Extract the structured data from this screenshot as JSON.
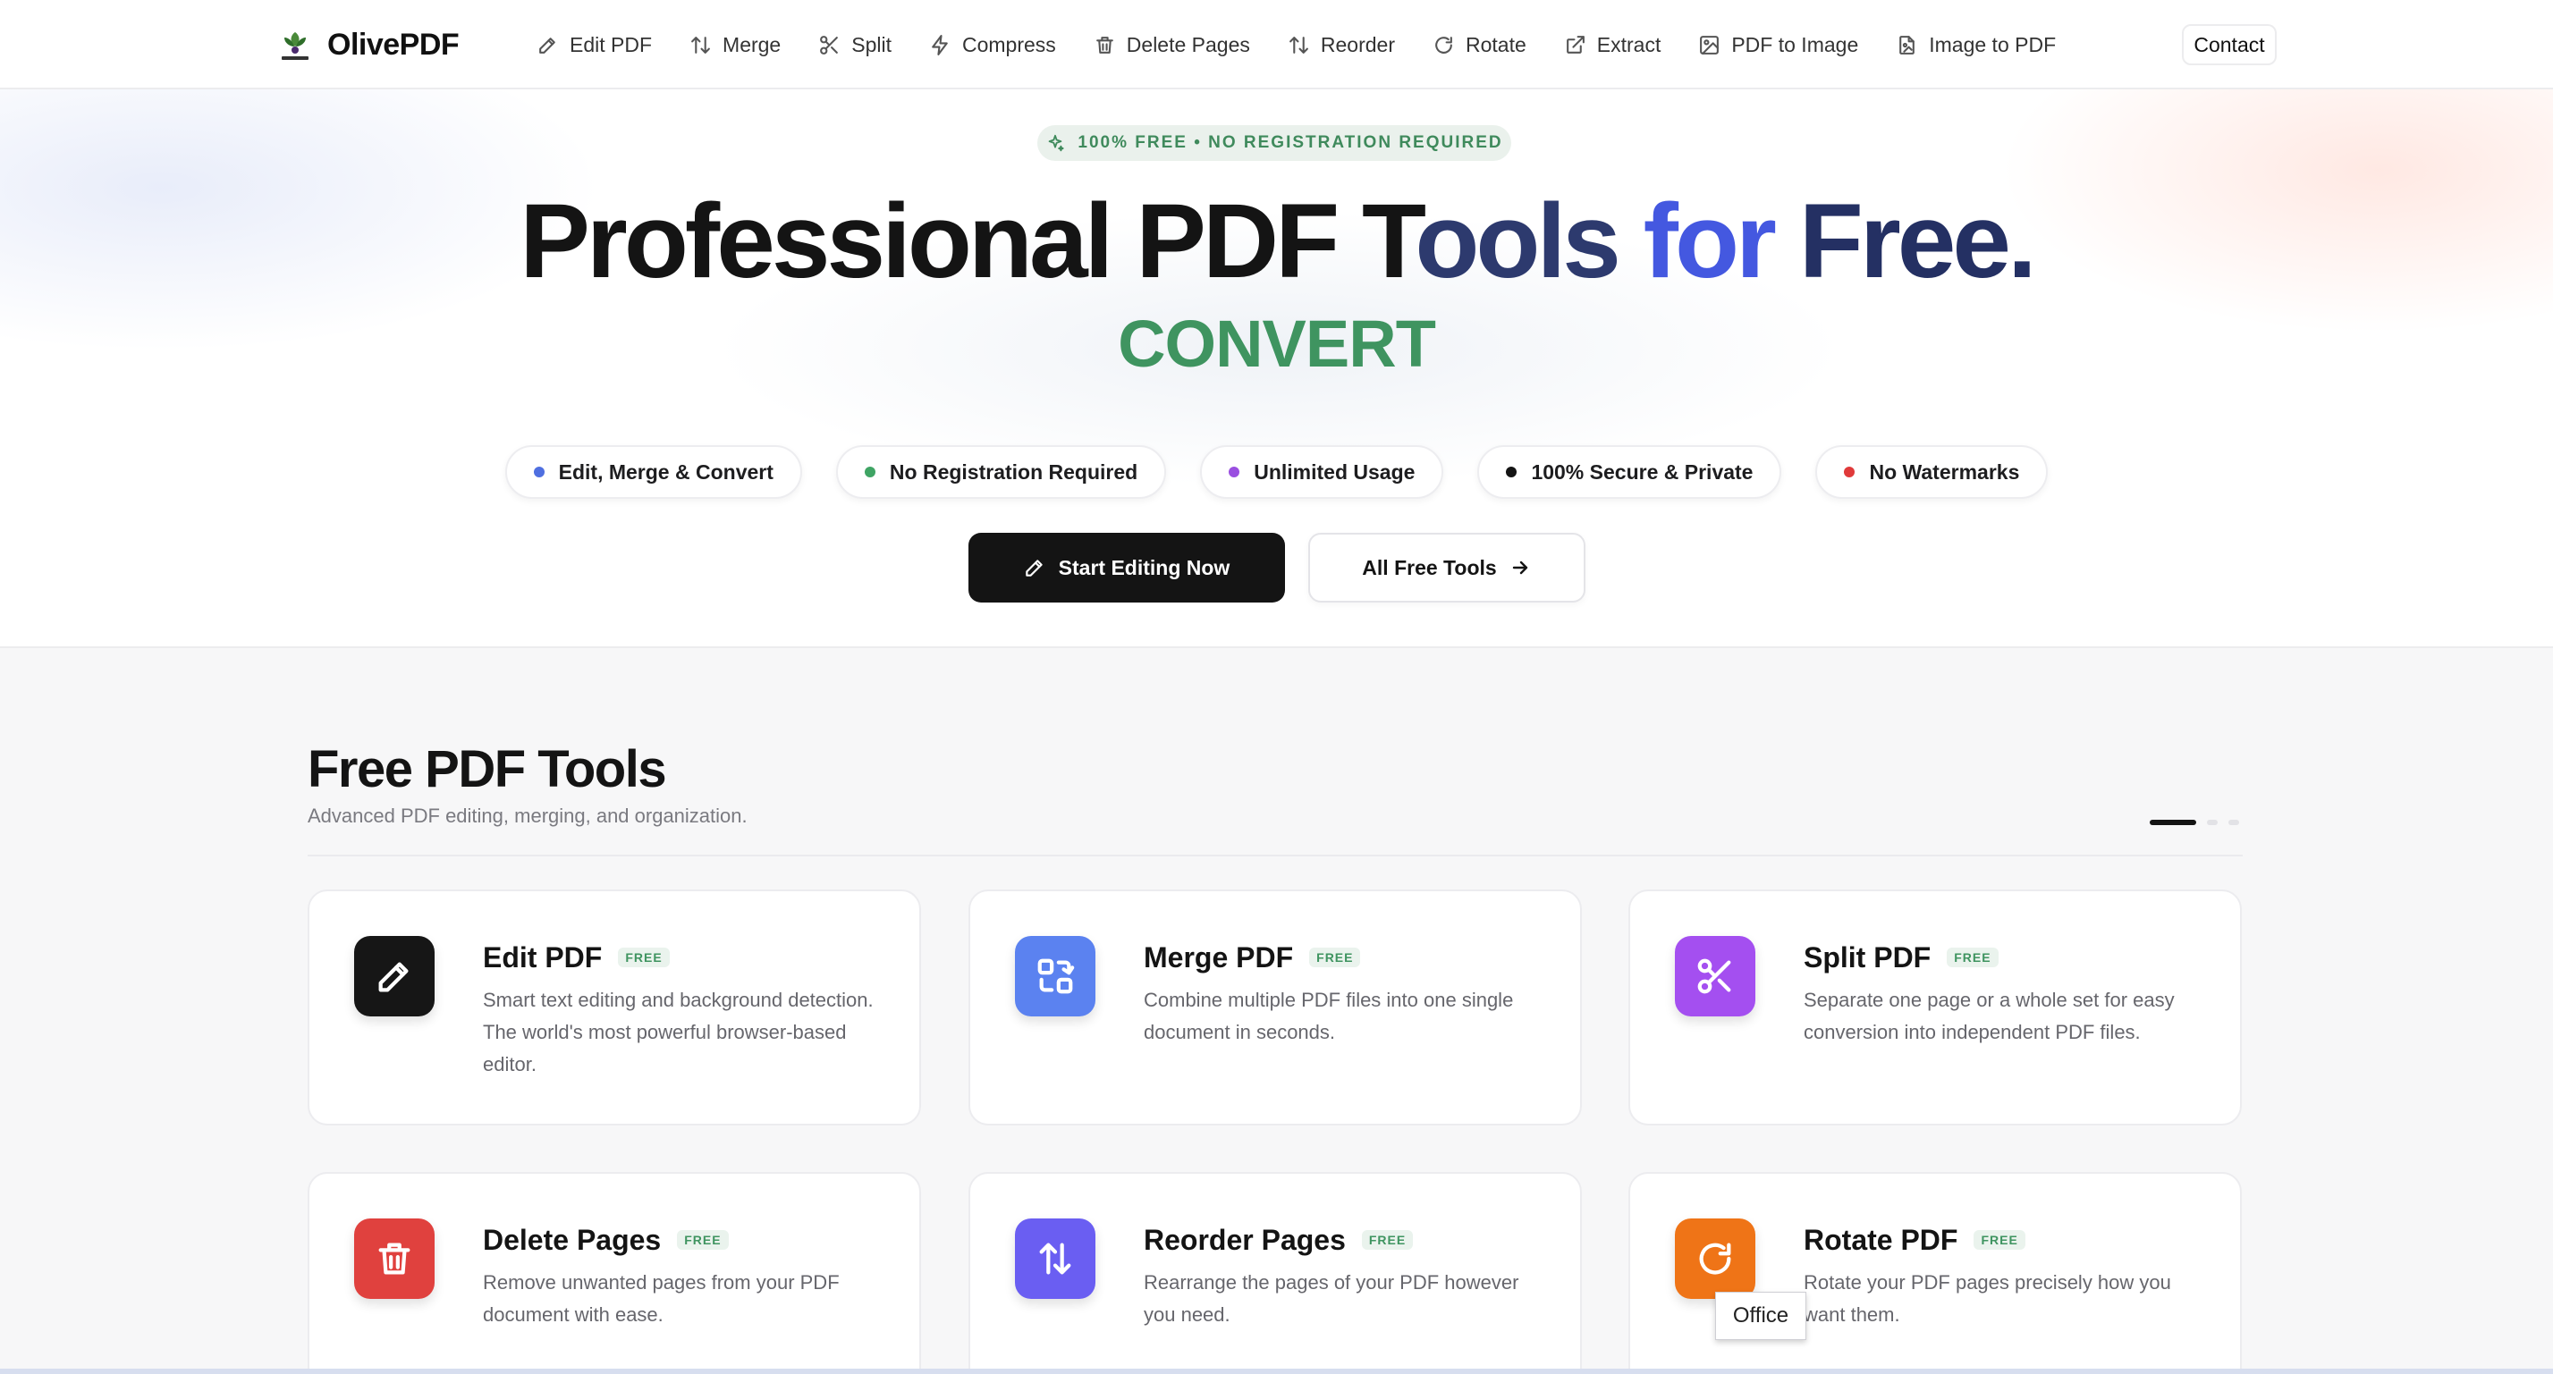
{
  "nav": {
    "brand": "OlivePDF",
    "logo_text": "OlivePDF",
    "links": [
      {
        "label": "Edit PDF",
        "icon": "pencil-icon"
      },
      {
        "label": "Merge",
        "icon": "arrows-up-down-icon"
      },
      {
        "label": "Split",
        "icon": "scissors-icon"
      },
      {
        "label": "Compress",
        "icon": "lightning-icon"
      },
      {
        "label": "Delete Pages",
        "icon": "trash-icon"
      },
      {
        "label": "Reorder",
        "icon": "arrows-up-down-icon"
      },
      {
        "label": "Rotate",
        "icon": "rotate-icon"
      },
      {
        "label": "Extract",
        "icon": "external-link-icon"
      },
      {
        "label": "PDF to Image",
        "icon": "image-icon"
      },
      {
        "label": "Image to PDF",
        "icon": "file-image-icon"
      }
    ],
    "contact": "Contact"
  },
  "hero": {
    "badge": "100% FREE • NO REGISTRATION REQUIRED",
    "title_part1": "Professional PDF T",
    "title_part2": "ools ",
    "title_part3": "for ",
    "title_part4": "Free.",
    "rotating_word": "CONVERT",
    "pills": [
      {
        "label": "Edit, Merge & Convert",
        "dot_color": "#4f6fe0"
      },
      {
        "label": "No Registration Required",
        "dot_color": "#3fa464"
      },
      {
        "label": "Unlimited Usage",
        "dot_color": "#9a4fe0"
      },
      {
        "label": "100% Secure & Private",
        "dot_color": "#141414"
      },
      {
        "label": "No Watermarks",
        "dot_color": "#e03a3a"
      }
    ],
    "cta_primary": "Start Editing Now",
    "cta_secondary": "All Free Tools"
  },
  "tools": {
    "title": "Free PDF Tools",
    "subtitle": "Advanced PDF editing, merging, and organization.",
    "free_tag": "FREE",
    "cards": [
      {
        "title": "Edit PDF",
        "description": "Smart text editing and background detection. The world's most powerful browser-based editor.",
        "icon": "pencil-icon",
        "color": "#161616"
      },
      {
        "title": "Merge PDF",
        "description": "Combine multiple PDF files into one single document in seconds.",
        "icon": "merge-icon",
        "color": "#5b82f0"
      },
      {
        "title": "Split PDF",
        "description": "Separate one page or a whole set for easy conversion into independent PDF files.",
        "icon": "scissors-icon",
        "color": "#a44ff0"
      },
      {
        "title": "Delete Pages",
        "description": "Remove unwanted pages from your PDF document with ease.",
        "icon": "trash-icon",
        "color": "#e0413e"
      },
      {
        "title": "Reorder Pages",
        "description": "Rearrange the pages of your PDF however you need.",
        "icon": "arrows-up-down-icon",
        "color": "#6a5ef2"
      },
      {
        "title": "Rotate PDF",
        "description": "Rotate your PDF pages precisely how you want them.",
        "icon": "rotate-icon",
        "color": "#ef7417"
      }
    ]
  },
  "tooltip": "Office",
  "colors": {
    "accent_green": "#3f9460",
    "accent_blue": "#4458e0",
    "dark": "#141414"
  }
}
